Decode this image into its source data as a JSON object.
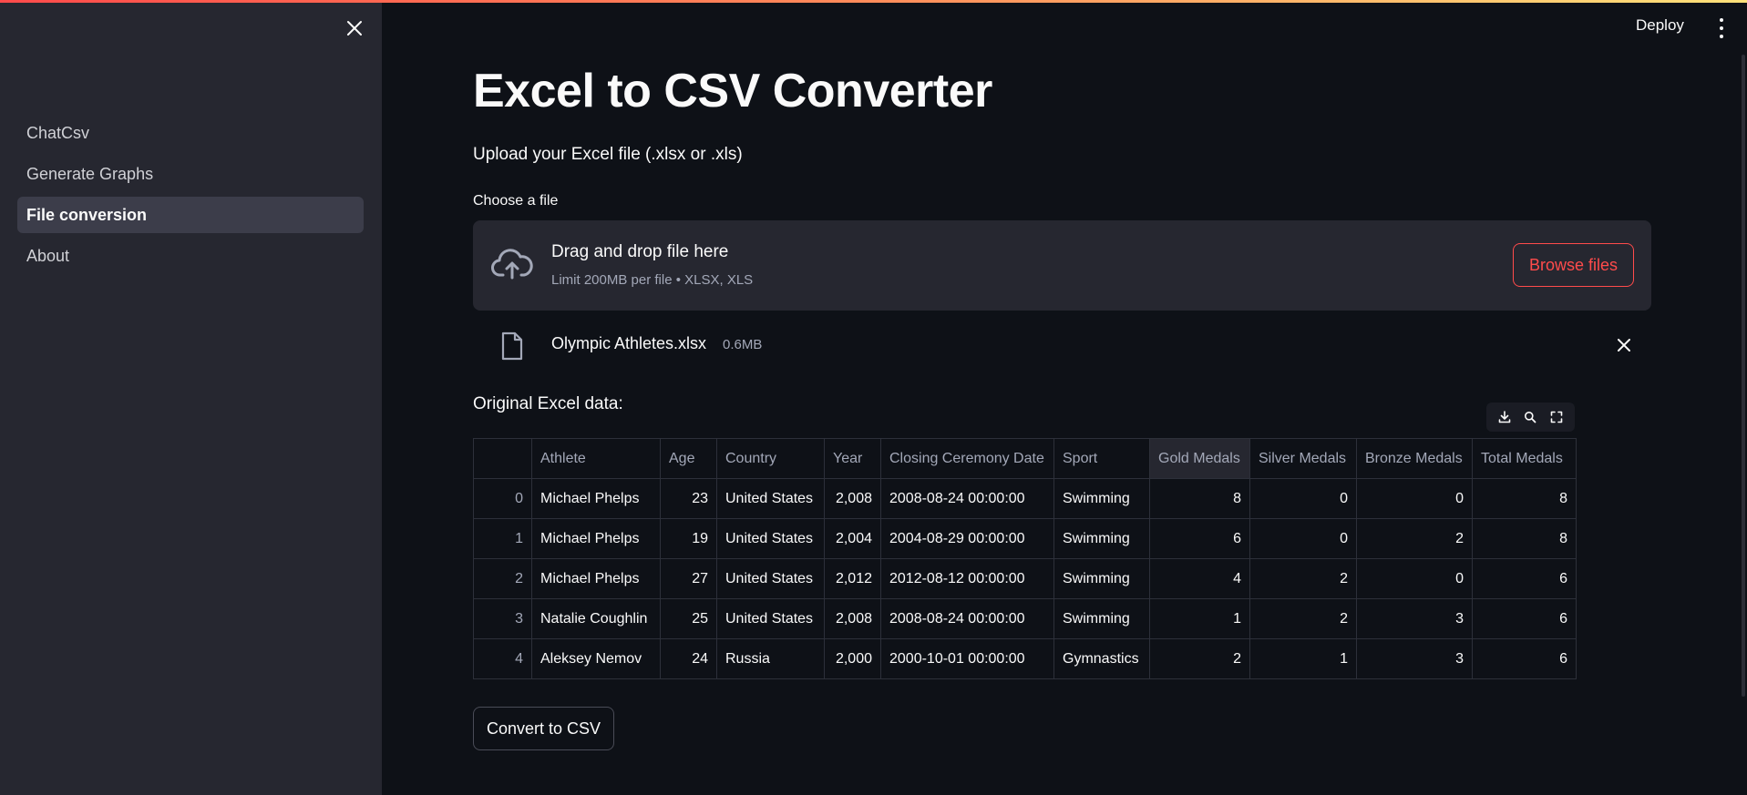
{
  "app": {
    "deploy_label": "Deploy"
  },
  "sidebar": {
    "items": [
      {
        "label": "ChatCsv"
      },
      {
        "label": "Generate Graphs"
      },
      {
        "label": "File conversion"
      },
      {
        "label": "About"
      }
    ]
  },
  "main": {
    "title": "Excel to CSV Converter",
    "subtitle": "Upload your Excel file (.xlsx or .xls)",
    "uploader": {
      "label": "Choose a file",
      "drop_title": "Drag and drop file here",
      "limit_text": "Limit 200MB per file • XLSX, XLS",
      "browse_label": "Browse files"
    },
    "uploaded_file": {
      "name": "Olympic Athletes.xlsx",
      "size": "0.6MB"
    },
    "data_label": "Original Excel data:",
    "table": {
      "columns": [
        "",
        "Athlete",
        "Age",
        "Country",
        "Year",
        "Closing Ceremony Date",
        "Sport",
        "Gold Medals",
        "Silver Medals",
        "Bronze Medals",
        "Total Medals"
      ],
      "rows": [
        [
          "0",
          "Michael Phelps",
          "23",
          "United States",
          "2,008",
          "2008-08-24 00:00:00",
          "Swimming",
          "8",
          "0",
          "0",
          "8"
        ],
        [
          "1",
          "Michael Phelps",
          "19",
          "United States",
          "2,004",
          "2004-08-29 00:00:00",
          "Swimming",
          "6",
          "0",
          "2",
          "8"
        ],
        [
          "2",
          "Michael Phelps",
          "27",
          "United States",
          "2,012",
          "2012-08-12 00:00:00",
          "Swimming",
          "4",
          "2",
          "0",
          "6"
        ],
        [
          "3",
          "Natalie Coughlin",
          "25",
          "United States",
          "2,008",
          "2008-08-24 00:00:00",
          "Swimming",
          "1",
          "2",
          "3",
          "6"
        ],
        [
          "4",
          "Aleksey Nemov",
          "24",
          "Russia",
          "2,000",
          "2000-10-01 00:00:00",
          "Gymnastics",
          "2",
          "1",
          "3",
          "6"
        ]
      ]
    },
    "convert_label": "Convert to CSV"
  },
  "colors": {
    "background": "#0e1117",
    "sidebar": "#262730",
    "accent": "#ff4b4b",
    "text": "#fafafa",
    "muted": "#a3a8b8"
  },
  "icons": [
    "close-icon",
    "more-vertical-icon",
    "cloud-upload-icon",
    "file-icon",
    "download-icon",
    "search-icon",
    "fullscreen-icon"
  ]
}
